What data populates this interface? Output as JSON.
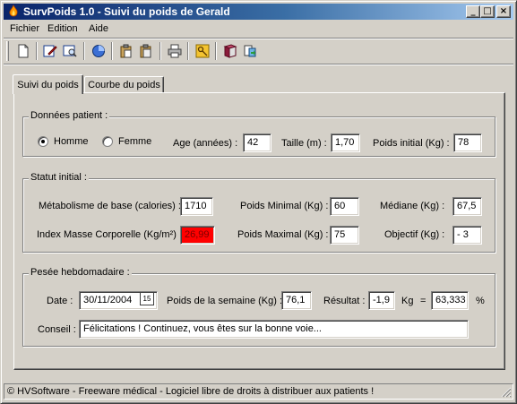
{
  "window": {
    "title": "SurvPoids 1.0 - Suivi du poids de Gerald",
    "controls": {
      "minimize": "_",
      "maximize": "□",
      "close": "×"
    }
  },
  "menu": {
    "items": [
      "Fichier",
      "Edition",
      "Aide"
    ]
  },
  "toolbar": {
    "buttons": [
      "new-document-icon",
      "edit-icon",
      "preview-icon",
      "chart-icon",
      "paste-icon",
      "paste-special-icon",
      "print-icon",
      "key-icon",
      "book-icon",
      "export-icon"
    ]
  },
  "tabs": [
    {
      "label": "Suivi du poids",
      "active": true
    },
    {
      "label": "Courbe du poids",
      "active": false
    }
  ],
  "patient": {
    "title": "Données patient :",
    "sex_options": [
      "Homme",
      "Femme"
    ],
    "sex_selected": "Homme",
    "age_label": "Age (années) :",
    "age_value": "42",
    "height_label": "Taille (m) :",
    "height_value": "1,70",
    "initial_weight_label": "Poids initial (Kg) :",
    "initial_weight_value": "78"
  },
  "status": {
    "title": "Statut initial :",
    "bmr_label": "Métabolisme de base (calories) :",
    "bmr_value": "1710",
    "min_weight_label": "Poids Minimal (Kg) :",
    "min_weight_value": "60",
    "median_label": "Médiane (Kg) :",
    "median_value": "67,5",
    "bmi_label": "Index Masse Corporelle (Kg/m²) :",
    "bmi_value": "26,99",
    "bmi_color": "#ff0000",
    "max_weight_label": "Poids Maximal (Kg) :",
    "max_weight_value": "75",
    "goal_label": "Objectif (Kg) :",
    "goal_value": "- 3"
  },
  "weekly": {
    "title": "Pesée hebdomadaire :",
    "date_label": "Date :",
    "date_value": "30/11/2004",
    "calendar_label": "15",
    "week_weight_label": "Poids de la semaine (Kg) :",
    "week_weight_value": "76,1",
    "result_label": "Résultat :",
    "result_value": "-1,9",
    "kg_unit": "Kg",
    "equals": "=",
    "percent_value": "63,333",
    "percent_unit": "%",
    "advice_label": "Conseil :",
    "advice_value": "Félicitations ! Continuez, vous êtes sur la bonne voie..."
  },
  "statusbar": {
    "text": "© HVSoftware - Freeware médical - Logiciel libre de droits à distribuer aux patients !"
  }
}
